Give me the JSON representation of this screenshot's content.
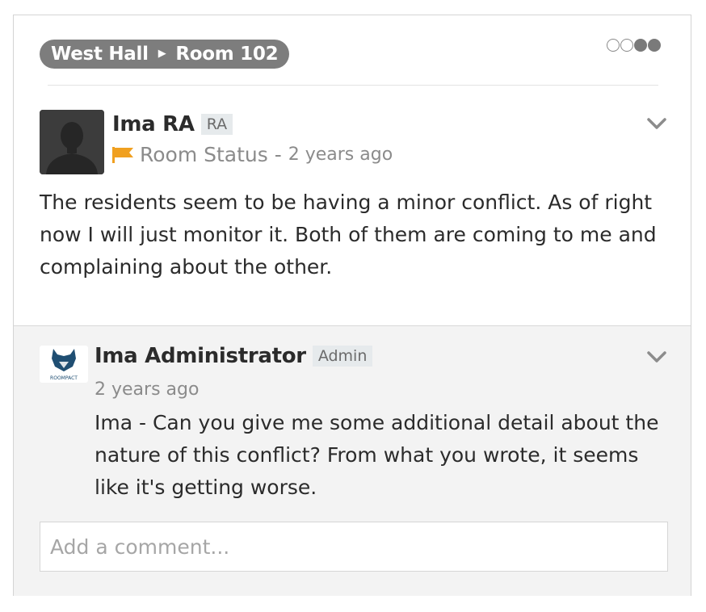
{
  "breadcrumb": {
    "building": "West Hall",
    "room": "Room 102"
  },
  "status_dots": {
    "empty": 2,
    "filled": 2
  },
  "post": {
    "author": "Ima RA",
    "role_badge": "RA",
    "category": "Room Status",
    "separator": " - ",
    "time": "2 years ago",
    "flag_color": "#f0a020",
    "text": "The residents seem to be having a minor conflict. As of right now I will just monitor it. Both of them are coming to me and complaining about the other."
  },
  "comment": {
    "author": "Ima Administrator",
    "role_badge": "Admin",
    "time": "2 years ago",
    "logo_text": "ROOMPACT",
    "logo_color": "#1f4e72",
    "text": "Ima - Can you give me some additional detail about the nature of this conflict? From what you wrote, it seems like it's getting worse."
  },
  "comment_input": {
    "placeholder": "Add a comment...",
    "value": ""
  }
}
